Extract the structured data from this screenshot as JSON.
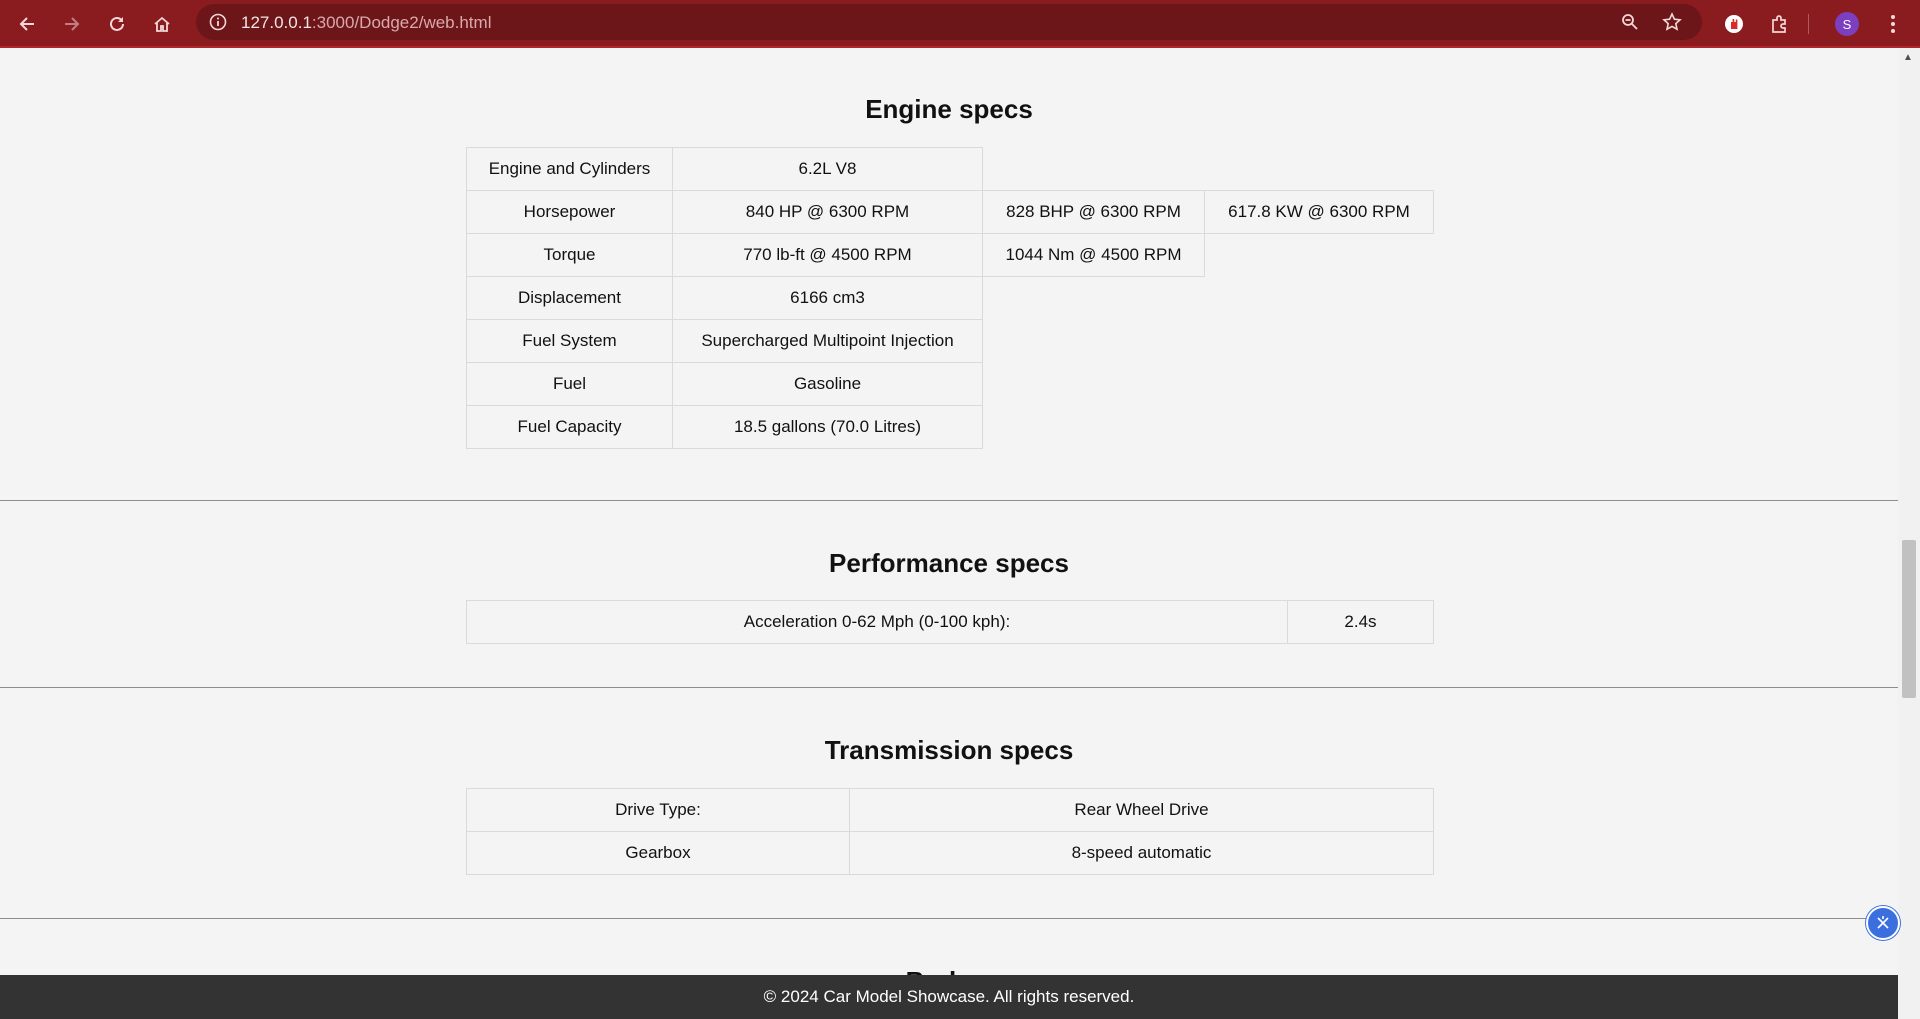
{
  "browser": {
    "url_host": "127.0.0.1",
    "url_path": ":3000/Dodge2/web.html",
    "profile_initial": "S"
  },
  "engine": {
    "title": "Engine specs",
    "rows": [
      [
        "Engine and Cylinders",
        "6.2L V8"
      ],
      [
        "Horsepower",
        "840 HP @ 6300 RPM",
        "828 BHP @ 6300 RPM",
        "617.8 KW @ 6300 RPM"
      ],
      [
        "Torque",
        "770 lb-ft @ 4500 RPM",
        "1044 Nm @ 4500 RPM"
      ],
      [
        "Displacement",
        "6166 cm3"
      ],
      [
        "Fuel System",
        "Supercharged Multipoint Injection"
      ],
      [
        "Fuel",
        "Gasoline"
      ],
      [
        "Fuel Capacity",
        "18.5 gallons (70.0 Litres)"
      ]
    ]
  },
  "performance": {
    "title": "Performance specs",
    "rows": [
      [
        "Acceleration 0-62 Mph (0-100 kph):",
        "2.4s"
      ]
    ]
  },
  "transmission": {
    "title": "Transmission specs",
    "rows": [
      [
        "Drive Type:",
        "Rear Wheel Drive"
      ],
      [
        "Gearbox",
        "8-speed automatic"
      ]
    ]
  },
  "next_section_peek": "Brakes",
  "footer": {
    "text": "© 2024 Car Model Showcase. All rights reserved."
  }
}
